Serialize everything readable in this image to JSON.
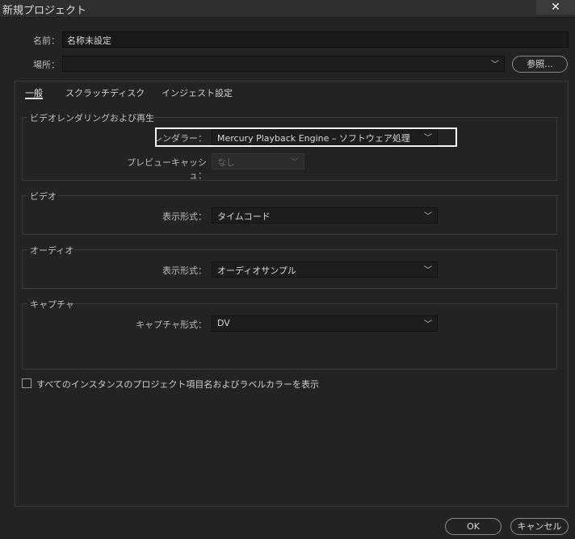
{
  "window": {
    "title": "新規プロジェクト",
    "close_glyph": "✕"
  },
  "name_row": {
    "label": "名前：",
    "value": "名称未設定"
  },
  "location_row": {
    "label": "場所：",
    "value": "",
    "browse_label": "参照..."
  },
  "tabs": [
    {
      "label": "一般",
      "active": true
    },
    {
      "label": "スクラッチディスク",
      "active": false
    },
    {
      "label": "インジェスト設定",
      "active": false
    }
  ],
  "groups": {
    "video_rendering": {
      "title": "ビデオレンダリングおよび再生",
      "renderer": {
        "label": "レンダラー：",
        "value": "Mercury Playback Engine – ソフトウェア処理"
      },
      "preview_cache": {
        "label": "プレビューキャッシュ：",
        "value": "なし"
      }
    },
    "video": {
      "title": "ビデオ",
      "display_format": {
        "label": "表示形式：",
        "value": "タイムコード"
      }
    },
    "audio": {
      "title": "オーディオ",
      "display_format": {
        "label": "表示形式：",
        "value": "オーディオサンプル"
      }
    },
    "capture": {
      "title": "キャプチャ",
      "capture_format": {
        "label": "キャプチャ形式：",
        "value": "DV"
      }
    }
  },
  "show_labels_checkbox": {
    "label": "すべてのインスタンスのプロジェクト項目名およびラベルカラーを表示",
    "checked": false
  },
  "footer": {
    "ok_label": "OK",
    "cancel_label": "キャンセル"
  },
  "icons": {
    "dropdown": "chevron-down-icon",
    "close": "close-icon"
  },
  "colors": {
    "background": "#232323",
    "highlight_border": "#f4f4f4"
  }
}
